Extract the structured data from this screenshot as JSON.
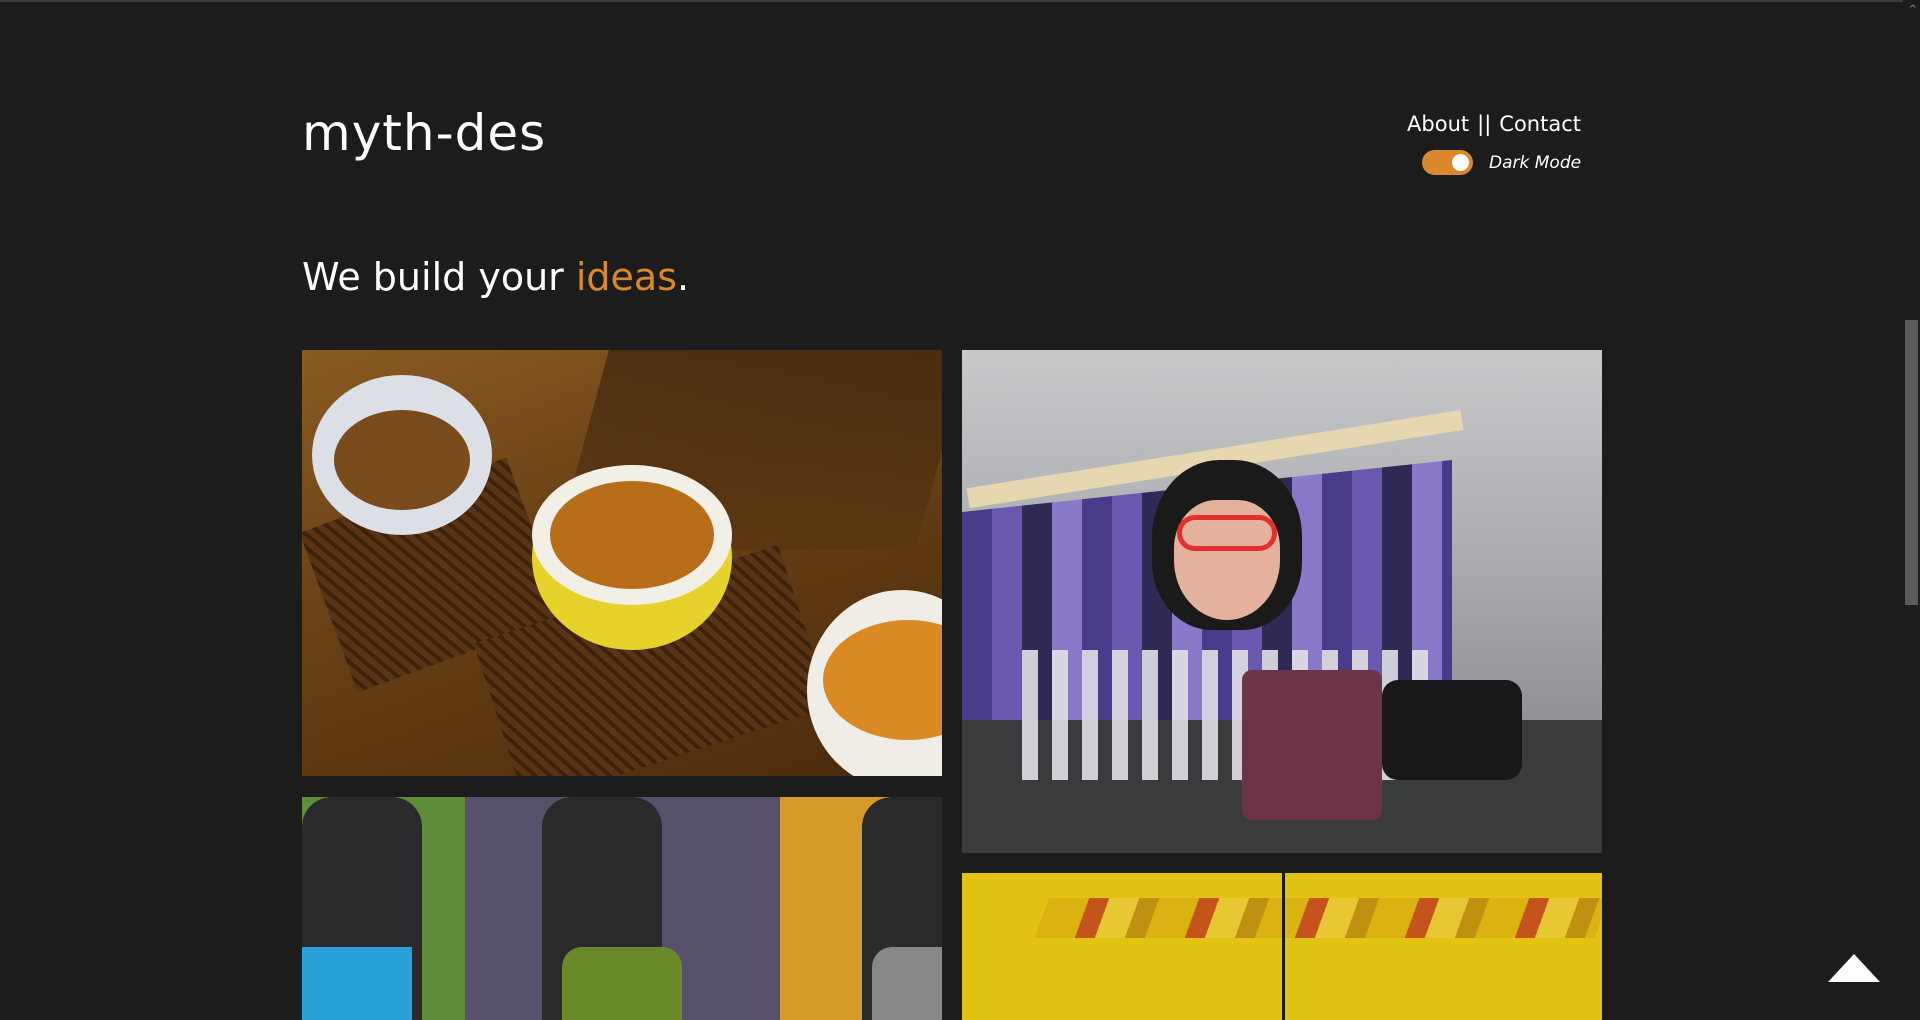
{
  "brand": {
    "logo": "myth-des"
  },
  "nav": {
    "about": "About",
    "separator": "||",
    "contact": "Contact"
  },
  "theme_toggle": {
    "label": "Dark Mode",
    "on": true,
    "color": "#d9892b"
  },
  "hero": {
    "prefix": "We build your ",
    "accent": "ideas",
    "suffix": "."
  },
  "gallery": [
    {
      "name": "tea-cups-image"
    },
    {
      "name": "mural-image"
    },
    {
      "name": "headphones-image"
    },
    {
      "name": "yellow-room-image"
    }
  ],
  "icons": {
    "scroll_top": "arrow-up-icon",
    "scroll_up": "chevron-up-icon"
  },
  "colors": {
    "background": "#1c1c1c",
    "accent": "#d9892b",
    "text": "#ffffff"
  }
}
